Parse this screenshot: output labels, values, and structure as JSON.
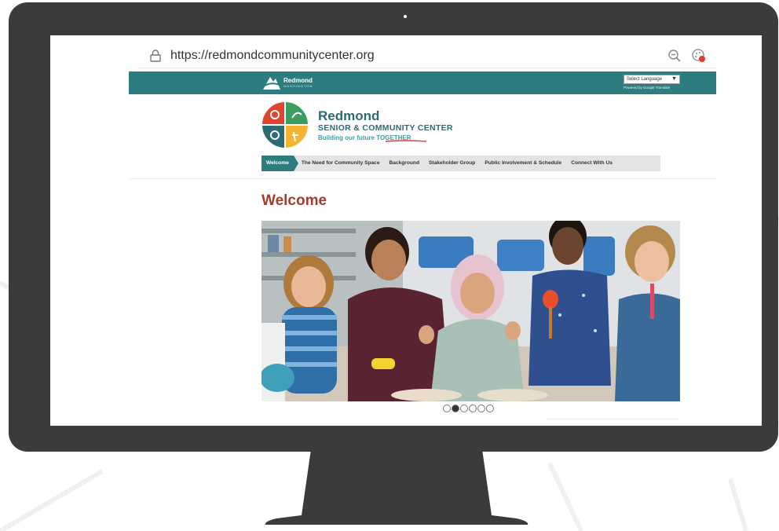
{
  "browser": {
    "url": "https://redmondcommunitycenter.org"
  },
  "site": {
    "city_name": "Redmond",
    "city_sub": "WASHINGTON",
    "language_select": "Select Language",
    "powered_by": "Powered by Google Translate",
    "brand_title": "Redmond",
    "brand_subtitle": "SENIOR & COMMUNITY CENTER",
    "brand_tagline": "Building our future TOGETHER",
    "nav": [
      {
        "label": "Welcome",
        "active": true
      },
      {
        "label": "The Need for Community Space",
        "active": false
      },
      {
        "label": "Background",
        "active": false
      },
      {
        "label": "Stakeholder Group",
        "active": false
      },
      {
        "label": "Public Involvement & Schedule",
        "active": false
      },
      {
        "label": "Connect With Us",
        "active": false
      }
    ],
    "page_heading": "Welcome",
    "carousel": {
      "slide_count": 6,
      "active_index": 1
    }
  },
  "colors": {
    "monitor": "#3b3b3d",
    "teal": "#2d7d80",
    "heading_red": "#a43d2e",
    "brand_text": "#2c6b74"
  }
}
